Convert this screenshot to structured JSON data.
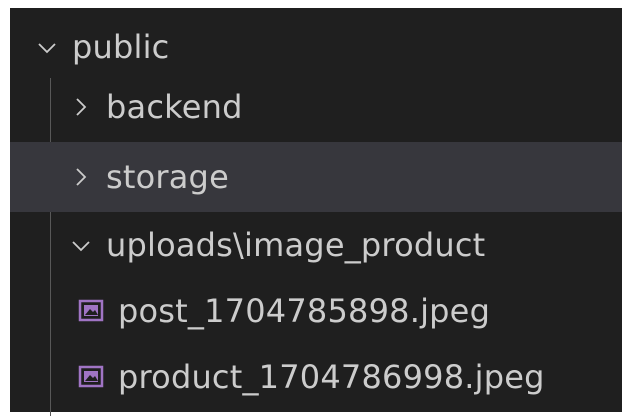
{
  "explorer": {
    "folders": [
      {
        "label": "public",
        "expanded": true,
        "icon": "chevron-down-icon"
      },
      {
        "label": "backend",
        "expanded": false,
        "icon": "chevron-right-icon"
      },
      {
        "label": "storage",
        "expanded": false,
        "icon": "chevron-right-icon",
        "selected": true
      },
      {
        "label": "uploads\\image_product",
        "expanded": true,
        "icon": "chevron-down-icon"
      }
    ],
    "files": [
      {
        "label": "post_1704785898.jpeg",
        "icon": "image-file-icon"
      },
      {
        "label": "product_1704786998.jpeg",
        "icon": "image-file-icon"
      }
    ],
    "colors": {
      "background": "#1f1f1f",
      "selected": "#37373d",
      "text": "#cccccc",
      "image_icon": "#a074c4"
    }
  }
}
